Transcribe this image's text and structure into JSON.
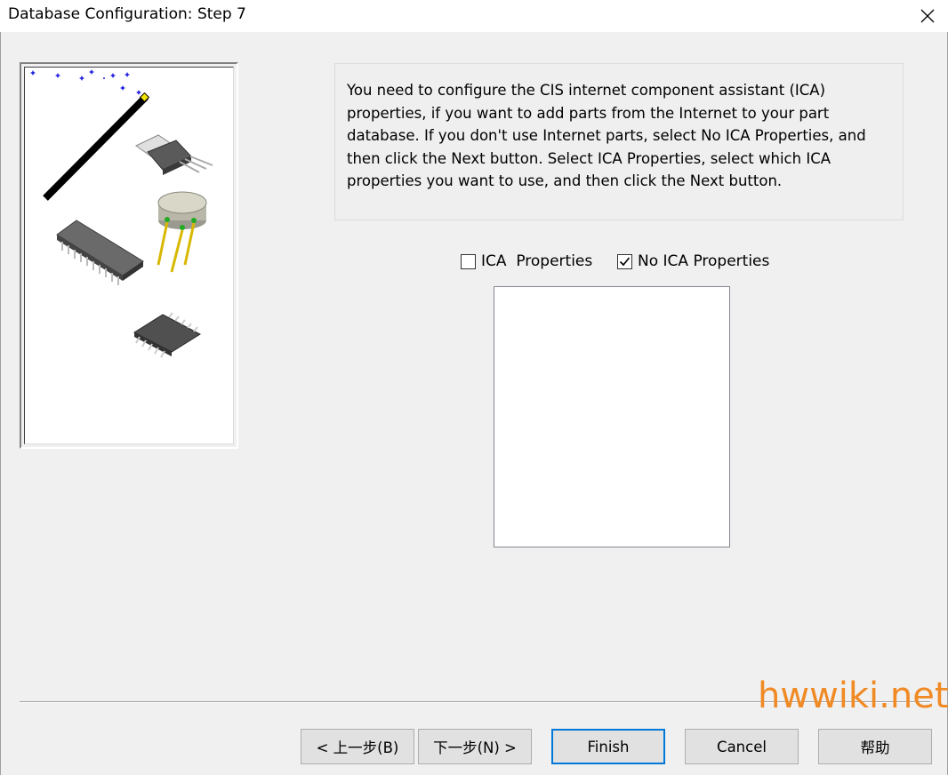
{
  "window": {
    "title": "Database Configuration: Step 7"
  },
  "description": "You need to configure the CIS internet component assistant (ICA) properties, if you want to add parts from the Internet to your part database. If you don't use Internet parts, select No ICA Properties, and then click the Next button. Select ICA Properties, select which ICA properties you want to use, and then click the Next button.",
  "options": {
    "ica_properties": {
      "label": "ICA  Properties",
      "checked": false
    },
    "no_ica_properties": {
      "label": "No ICA Properties",
      "checked": true
    }
  },
  "properties_list": {
    "items": []
  },
  "buttons": {
    "back": "< 上一步(B)",
    "next": "下一步(N) >",
    "finish": "Finish",
    "cancel": "Cancel",
    "help": "帮助"
  },
  "watermark": "hwwiki.net",
  "icons": [
    "close-icon",
    "magic-wand-icon",
    "to220-transistor-icon",
    "to39-transistor-icon",
    "dip-chip-icon",
    "soic-chip-icon"
  ]
}
